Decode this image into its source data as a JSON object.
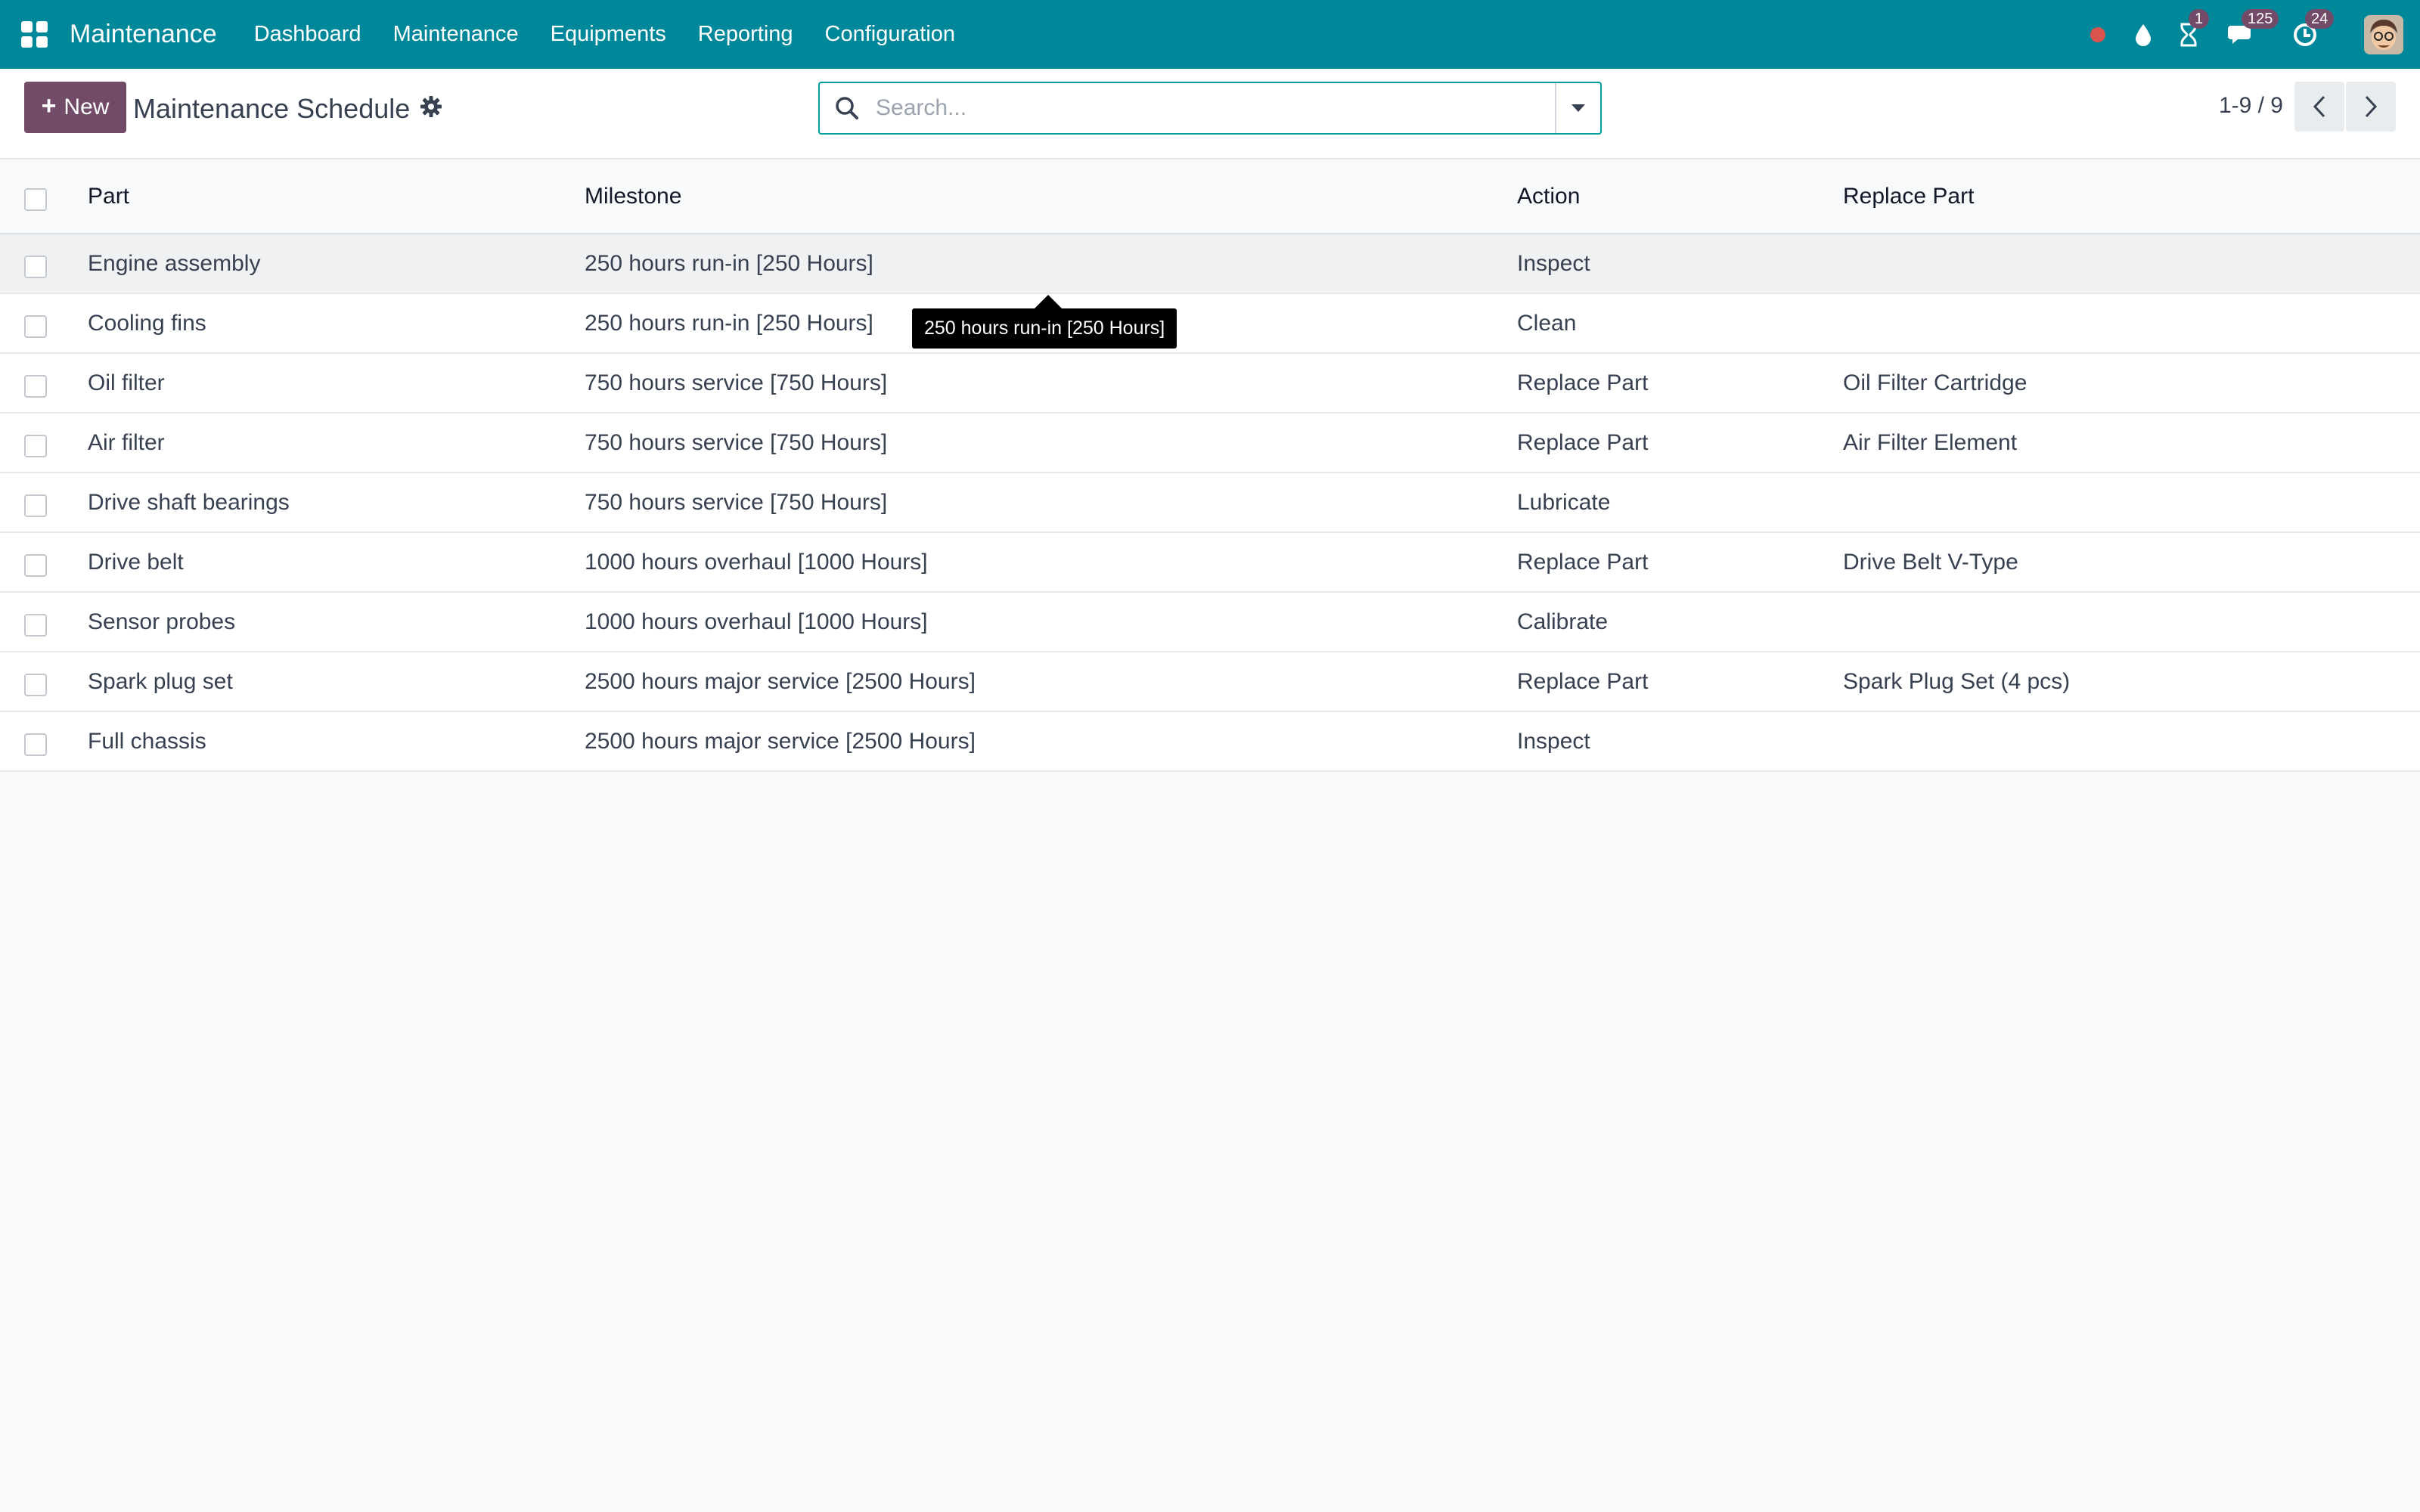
{
  "navbar": {
    "brand": "Maintenance",
    "menu": [
      "Dashboard",
      "Maintenance",
      "Equipments",
      "Reporting",
      "Configuration"
    ],
    "activity_badge": "1",
    "messages_badge": "125",
    "updates_badge": "24",
    "icons": [
      "apps-grid-icon",
      "record-dot-icon",
      "drop-icon",
      "hourglass-icon",
      "chat-icon",
      "clock-icon"
    ]
  },
  "control_panel": {
    "new_label": "New",
    "title": "Maintenance Schedule",
    "search_placeholder": "Search...",
    "pager": "1-9 / 9"
  },
  "table": {
    "columns": [
      "Part",
      "Milestone",
      "Action",
      "Replace Part"
    ],
    "rows": [
      {
        "part": "Engine assembly",
        "milestone": "250 hours run-in [250 Hours]",
        "action": "Inspect",
        "replace": ""
      },
      {
        "part": "Cooling fins",
        "milestone": "250 hours run-in [250 Hours]",
        "action": "Clean",
        "replace": ""
      },
      {
        "part": "Oil filter",
        "milestone": "750 hours service [750 Hours]",
        "action": "Replace Part",
        "replace": "Oil Filter Cartridge"
      },
      {
        "part": "Air filter",
        "milestone": "750 hours service [750 Hours]",
        "action": "Replace Part",
        "replace": "Air Filter Element"
      },
      {
        "part": "Drive shaft bearings",
        "milestone": "750 hours service [750 Hours]",
        "action": "Lubricate",
        "replace": ""
      },
      {
        "part": "Drive belt",
        "milestone": "1000 hours overhaul [1000 Hours]",
        "action": "Replace Part",
        "replace": "Drive Belt V-Type"
      },
      {
        "part": "Sensor probes",
        "milestone": "1000 hours overhaul [1000 Hours]",
        "action": "Calibrate",
        "replace": ""
      },
      {
        "part": "Spark plug set",
        "milestone": "2500 hours major service [2500 Hours]",
        "action": "Replace Part",
        "replace": "Spark Plug Set (4 pcs)"
      },
      {
        "part": "Full chassis",
        "milestone": "2500 hours major service [2500 Hours]",
        "action": "Inspect",
        "replace": ""
      }
    ]
  },
  "tooltip": "250 hours run-in [250 Hours]",
  "colors": {
    "navbar": "#00889a",
    "primary": "#714b67",
    "search_border": "#00a09d"
  }
}
